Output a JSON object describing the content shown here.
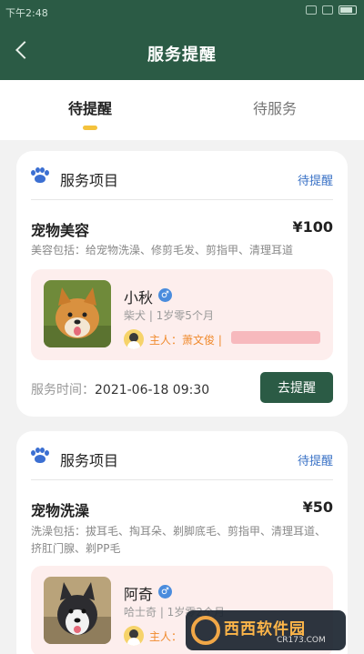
{
  "status_bar": {
    "time": "下午2:48"
  },
  "header": {
    "title": "服务提醒"
  },
  "tabs": [
    {
      "label": "待提醒",
      "active": true
    },
    {
      "label": "待服务",
      "active": false
    }
  ],
  "cards": [
    {
      "section_title": "服务项目",
      "status": "待提醒",
      "service_name": "宠物美容",
      "price": "¥100",
      "description": "美容包括：给宠物洗澡、修剪毛发、剪指甲、清理耳道",
      "pet": {
        "name": "小秋",
        "gender": "male",
        "meta": "柴犬 | 1岁零5个月",
        "owner": "主人：萧文俊 |"
      },
      "time_label": "服务时间：",
      "time_value": "2021-06-18 09:30",
      "action_label": "去提醒"
    },
    {
      "section_title": "服务项目",
      "status": "待提醒",
      "service_name": "宠物洗澡",
      "price": "¥50",
      "description": "洗澡包括：拔耳毛、掏耳朵、剃脚底毛、剪指甲、清理耳道、挤肛门腺、剃PP毛",
      "pet": {
        "name": "阿奇",
        "gender": "male",
        "meta": "哈士奇 | 1岁零2个月",
        "owner": "主人："
      }
    }
  ],
  "watermark": {
    "text": "西西软件园",
    "sub": "CR173.COM"
  },
  "colors": {
    "primary": "#2b5b45",
    "accent_blue": "#3a72c6",
    "pet_box_bg": "#fdeeed",
    "owner_orange": "#f08a2c",
    "indicator_yellow": "#f4c23c"
  }
}
